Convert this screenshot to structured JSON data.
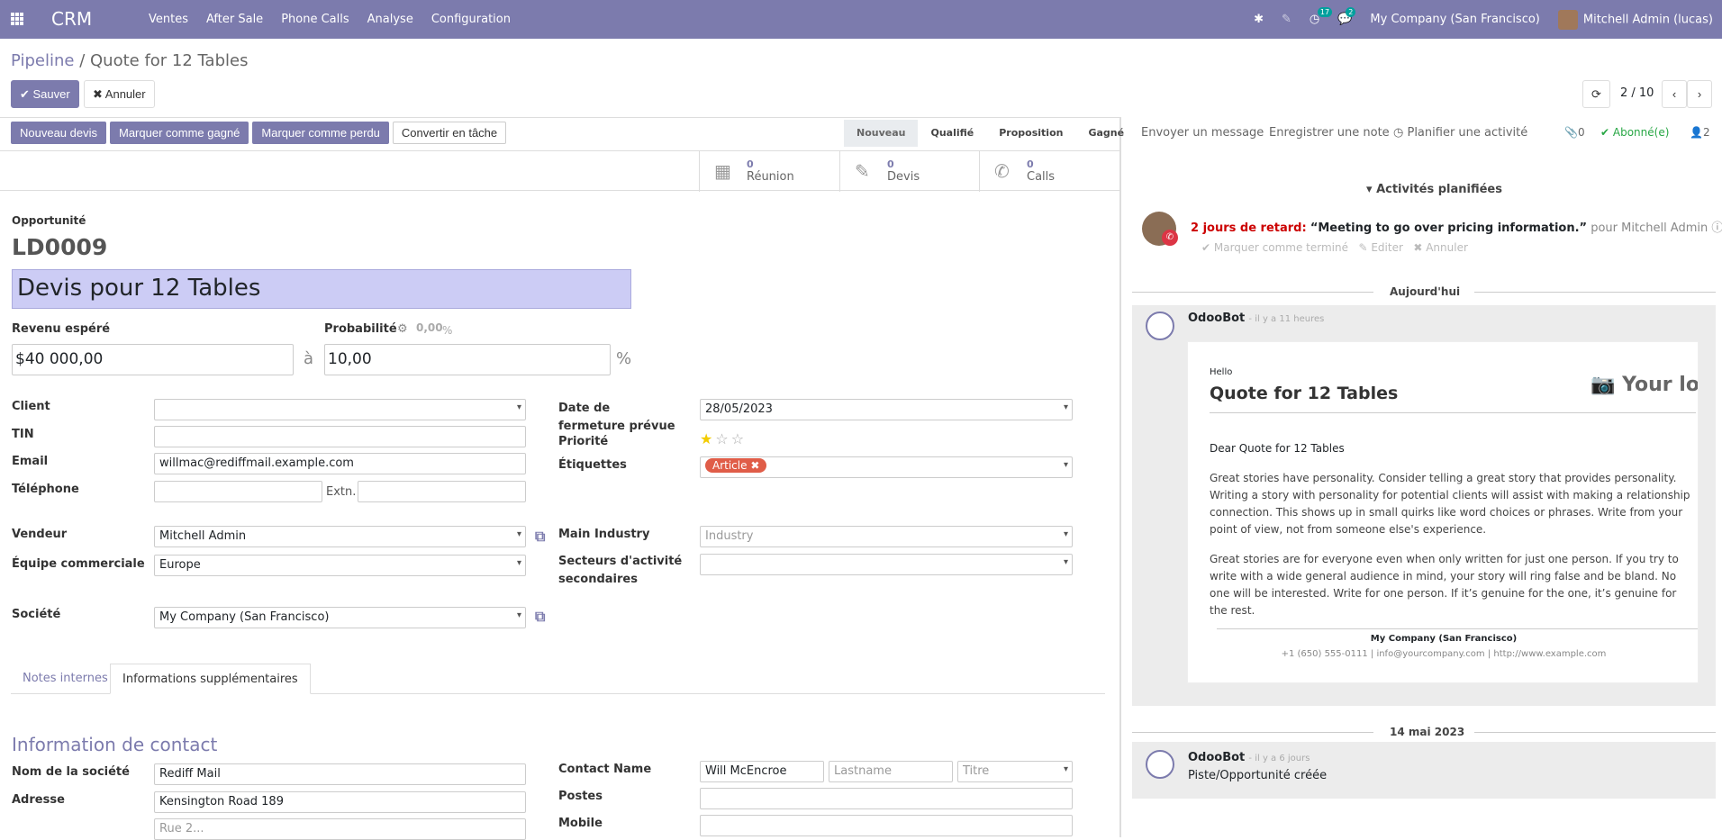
{
  "topbar": {
    "app": "CRM",
    "menu": [
      "Ventes",
      "After Sale",
      "Phone Calls",
      "Analyse",
      "Configuration"
    ],
    "activity_count": "17",
    "message_count": "2",
    "company": "My Company (San Francisco)",
    "user": "Mitchell Admin (lucas)"
  },
  "breadcrumb": {
    "parent": "Pipeline",
    "separator": "/",
    "current": "Quote for 12 Tables"
  },
  "actions": {
    "save": "Sauver",
    "discard": "Annuler"
  },
  "pager": {
    "value": "2 / 10"
  },
  "header_buttons": [
    "Nouveau devis",
    "Marquer comme gagné",
    "Marquer comme perdu",
    "Convertir en tâche"
  ],
  "stages": [
    "Nouveau",
    "Qualifié",
    "Proposition",
    "Gagné"
  ],
  "stat_buttons": [
    {
      "count": "0",
      "label": "Réunion",
      "icon": "calendar-icon"
    },
    {
      "count": "0",
      "label": "Devis",
      "icon": "edit-icon"
    },
    {
      "count": "0",
      "label": "Calls",
      "icon": "phone-icon"
    }
  ],
  "form": {
    "type_label": "Opportunité",
    "reference": "LD0009",
    "name": "Devis pour 12 Tables",
    "revenue_label": "Revenu espéré",
    "revenue": "$40 000,00",
    "at": "à",
    "probability_label": "Probabilité",
    "probability_auto": "0,00",
    "probability_auto_unit": "%",
    "probability": "10,00",
    "percent": "%",
    "client_label": "Client",
    "client": "",
    "tin_label": "TIN",
    "email_label": "Email",
    "email": "willmac@rediffmail.example.com",
    "phone_label": "Téléphone",
    "extn_label": "Extn.",
    "close_date_label": "Date de fermeture prévue",
    "close_date": "28/05/2023",
    "priority_label": "Priorité",
    "priority_stars": 1,
    "tags_label": "Étiquettes",
    "tag": "Article",
    "salesperson_label": "Vendeur",
    "salesperson": "Mitchell Admin",
    "team_label": "Équipe commerciale",
    "team": "Europe",
    "industry_label": "Main Industry",
    "industry_placeholder": "Industry",
    "secondary_label": "Secteurs d'activité secondaires",
    "company_label": "Société",
    "company": "My Company (San Francisco)"
  },
  "tabs": [
    "Notes internes",
    "Informations supplémentaires"
  ],
  "contact": {
    "section_title": "Information de contact",
    "company_name_label": "Nom de la société",
    "company_name": "Rediff Mail",
    "address_label": "Adresse",
    "street": "Kensington Road 189",
    "street2_placeholder": "Rue 2...",
    "contact_name_label": "Contact Name",
    "first_name": "Will McEncroe",
    "lastname_placeholder": "Lastname",
    "title_placeholder": "Titre",
    "postes_label": "Postes",
    "mobile_label": "Mobile"
  },
  "chatter": {
    "send_message": "Envoyer un message",
    "log_note": "Enregistrer une note",
    "schedule": "Planifier une activité",
    "attachments": "0",
    "followed": "Abonné(e)",
    "followers": "2",
    "planned_title": "Activités planifiées",
    "activity_late": "2 jours de retard:",
    "activity_summary": "“Meeting to go over pricing information.”",
    "activity_for": "pour Mitchell Admin",
    "mark_done": "Marquer comme terminé",
    "edit": "Editer",
    "cancel": "Annuler",
    "today": "Aujourd'hui",
    "msg1_author": "OdooBot",
    "msg1_time": "- il y a 11 heures",
    "email_hello": "Hello",
    "email_title": "Quote for 12 Tables",
    "email_logo": "Your lo",
    "email_dear": "Dear Quote for 12 Tables",
    "email_p1": "Great stories have personality. Consider telling a great story that provides personality. Writing a story with personality for potential clients will assist with making a relationship connection. This shows up in small quirks like word choices or phrases. Write from your point of view, not from someone else's experience.",
    "email_p2": "Great stories are for everyone even when only written for just one person. If you try to write with a wide general audience in mind, your story will ring false and be bland. No one will be interested. Write for one person. If it’s genuine for the one, it’s genuine for the rest.",
    "email_company": "My Company (San Francisco)",
    "email_footer": "+1 (650) 555-0111 | info@yourcompany.com | http://www.example.com",
    "date2": "14 mai 2023",
    "msg2_author": "OdooBot",
    "msg2_time": "- il y a 6 jours",
    "msg2_body": "Piste/Opportunité créée"
  }
}
